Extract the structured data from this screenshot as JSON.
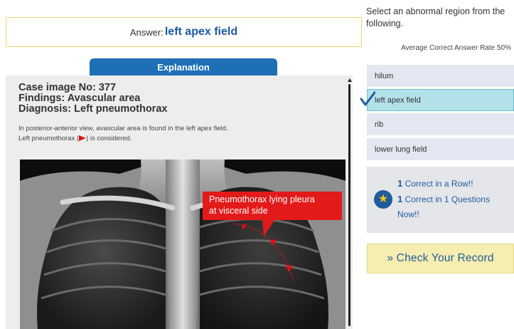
{
  "answer": {
    "prefix": "Answer:",
    "value": "left apex field"
  },
  "explanation_tab": "Explanation",
  "case": {
    "image_no": "Case image No: 377",
    "findings": "Findings: Avascular area",
    "diagnosis": "Diagnosis: Left pneumothorax",
    "description_line1": "In posterior-anterior view, avascular area is found in the left apex field.",
    "description_line2_before": "Left pneumothorax (",
    "description_line2_after": ") is considered."
  },
  "callout": {
    "line1": "Pneumothorax lying pleura",
    "line2": "at visceral side"
  },
  "question": {
    "prompt": "Select an abnormal region from the following."
  },
  "rate_text": "Average Correct Answer Rate 50%",
  "options": [
    {
      "label": "hilum"
    },
    {
      "label": "left apex field"
    },
    {
      "label": "rib"
    },
    {
      "label": "lower lung field"
    }
  ],
  "selected_option": "left apex field",
  "score": {
    "streak_count": "1",
    "streak_text": " Correct in a Row!!",
    "total_count": "1",
    "total_text": " Correct in 1 Questions",
    "now_text": "Now!!"
  },
  "record_button": "» Check Your Record",
  "colors": {
    "accent_blue": "#1e6fb6",
    "answer_border": "#e6d86a",
    "callout_red": "#e21a1a",
    "selected_option": "#b3e1ea",
    "record_button_bg": "#f6eeb0"
  },
  "icons": {
    "checkmark": "check-icon",
    "star": "star-badge-icon",
    "arrowhead": "red-arrowhead-icon"
  }
}
